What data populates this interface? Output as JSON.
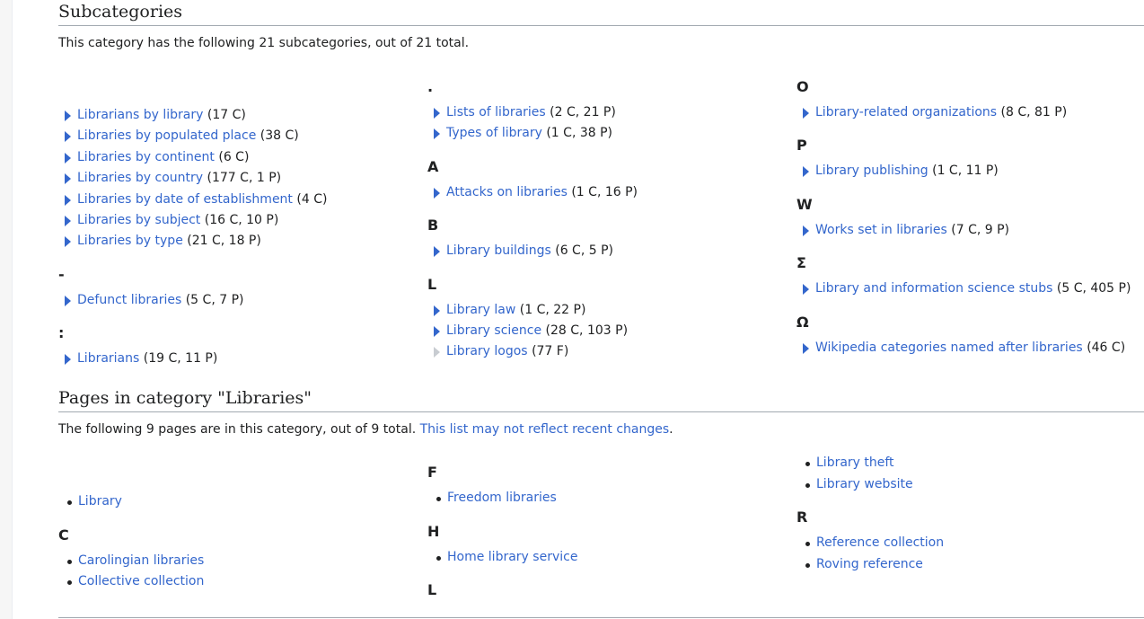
{
  "subcategories": {
    "heading": "Subcategories",
    "description": "This category has the following 21 subcategories, out of 21 total.",
    "columns": [
      {
        "groups": [
          {
            "letter": "",
            "items": [
              {
                "label": "Librarians by library",
                "count": "(17 C)"
              },
              {
                "label": "Libraries by populated place",
                "count": "(38 C)"
              },
              {
                "label": "Libraries by continent",
                "count": "(6 C)"
              },
              {
                "label": "Libraries by country",
                "count": "(177 C, 1 P)"
              },
              {
                "label": "Libraries by date of establishment",
                "count": "(4 C)"
              },
              {
                "label": "Libraries by subject",
                "count": "(16 C, 10 P)"
              },
              {
                "label": "Libraries by type",
                "count": "(21 C, 18 P)"
              }
            ]
          },
          {
            "letter": "-",
            "items": [
              {
                "label": "Defunct libraries",
                "count": "(5 C, 7 P)"
              }
            ]
          },
          {
            "letter": ":",
            "items": [
              {
                "label": "Librarians",
                "count": "(19 C, 11 P)"
              }
            ]
          }
        ]
      },
      {
        "groups": [
          {
            "letter": ".",
            "items": [
              {
                "label": "Lists of libraries",
                "count": "(2 C, 21 P)"
              },
              {
                "label": "Types of library",
                "count": "(1 C, 38 P)"
              }
            ]
          },
          {
            "letter": "A",
            "items": [
              {
                "label": "Attacks on libraries",
                "count": "(1 C, 16 P)"
              }
            ]
          },
          {
            "letter": "B",
            "items": [
              {
                "label": "Library buildings",
                "count": "(6 C, 5 P)"
              }
            ]
          },
          {
            "letter": "L",
            "items": [
              {
                "label": "Library law",
                "count": "(1 C, 22 P)"
              },
              {
                "label": "Library science",
                "count": "(28 C, 103 P)"
              },
              {
                "label": "Library logos",
                "count": "(77 F)",
                "empty": true
              }
            ]
          }
        ]
      },
      {
        "groups": [
          {
            "letter": "O",
            "items": [
              {
                "label": "Library-related organizations",
                "count": "(8 C, 81 P)"
              }
            ]
          },
          {
            "letter": "P",
            "items": [
              {
                "label": "Library publishing",
                "count": "(1 C, 11 P)"
              }
            ]
          },
          {
            "letter": "W",
            "items": [
              {
                "label": "Works set in libraries",
                "count": "(7 C, 9 P)"
              }
            ]
          },
          {
            "letter": "Σ",
            "items": [
              {
                "label": "Library and information science stubs",
                "count": "(5 C, 405 P)"
              }
            ]
          },
          {
            "letter": "Ω",
            "items": [
              {
                "label": "Wikipedia categories named after libraries",
                "count": "(46 C)"
              }
            ]
          }
        ]
      }
    ]
  },
  "pages": {
    "heading": "Pages in category \"Libraries\"",
    "description_prefix": "The following 9 pages are in this category, out of 9 total. ",
    "description_link": "This list may not reflect recent changes",
    "description_suffix": ".",
    "columns": [
      {
        "groups": [
          {
            "letter": "",
            "items": [
              "Library"
            ]
          },
          {
            "letter": "C",
            "items": [
              "Carolingian libraries",
              "Collective collection"
            ]
          }
        ]
      },
      {
        "groups": [
          {
            "letter": "F",
            "items": [
              "Freedom libraries"
            ]
          },
          {
            "letter": "H",
            "items": [
              "Home library service"
            ]
          },
          {
            "letter": "L",
            "items": []
          }
        ]
      },
      {
        "groups": [
          {
            "letter": "",
            "items": [
              "Library theft",
              "Library website"
            ]
          },
          {
            "letter": "R",
            "items": [
              "Reference collection",
              "Roving reference"
            ]
          }
        ]
      }
    ]
  },
  "colors": {
    "link": "#3366cc",
    "text": "#202122",
    "rule": "#a2a9b1",
    "empty_triangle": "#c8ccd1"
  }
}
